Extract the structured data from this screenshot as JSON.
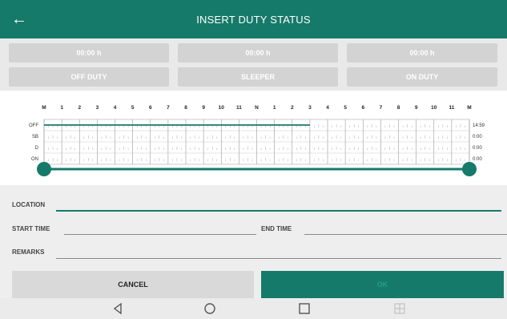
{
  "header": {
    "title": "INSERT DUTY STATUS",
    "back_icon": "back-arrow-icon"
  },
  "durations": [
    "00:00 h",
    "00:00 h",
    "00:00 h"
  ],
  "status_buttons": [
    "OFF DUTY",
    "SLEEPER",
    "ON DUTY"
  ],
  "chart": {
    "hour_labels": [
      "M",
      "1",
      "2",
      "3",
      "4",
      "5",
      "6",
      "7",
      "8",
      "9",
      "10",
      "11",
      "N",
      "1",
      "2",
      "3",
      "4",
      "5",
      "6",
      "7",
      "8",
      "9",
      "10",
      "11",
      "M"
    ],
    "rows": [
      "OFF",
      "SB",
      "D",
      "ON"
    ],
    "totals": [
      "14:59",
      "0:00",
      "0:00",
      "0:00"
    ],
    "off_duty_until_hour": 15,
    "accent": "#167a6a"
  },
  "form": {
    "location_label": "LOCATION",
    "start_label": "START TIME",
    "end_label": "END TIME",
    "remarks_label": "REMARKS",
    "cancel_label": "CANCEL",
    "ok_label": "OK"
  },
  "navbar": {
    "back": "nav-back-icon",
    "home": "nav-home-icon",
    "recents": "nav-recents-icon",
    "multiwindow": "nav-multiwindow-icon"
  }
}
